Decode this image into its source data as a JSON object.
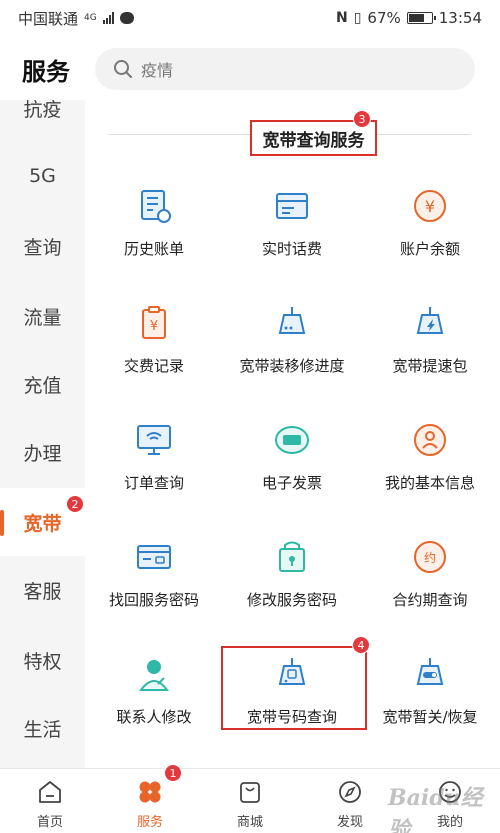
{
  "status_bar": {
    "carrier": "中国联通",
    "network": "4G",
    "battery": "67%",
    "battery_level": 0.67,
    "time": "13:54"
  },
  "header": {
    "title": "服务",
    "search_placeholder": "疫情"
  },
  "sidebar": {
    "items": [
      {
        "label": "抗疫",
        "active": false
      },
      {
        "label": "5G",
        "active": false
      },
      {
        "label": "查询",
        "active": false
      },
      {
        "label": "流量",
        "active": false
      },
      {
        "label": "充值",
        "active": false
      },
      {
        "label": "办理",
        "active": false
      },
      {
        "label": "宽带",
        "active": true
      },
      {
        "label": "客服",
        "active": false
      },
      {
        "label": "特权",
        "active": false
      },
      {
        "label": "生活",
        "active": false
      }
    ]
  },
  "section": {
    "title": "宽带查询服务"
  },
  "services": [
    {
      "label": "历史账单",
      "icon": "bill-history-icon"
    },
    {
      "label": "实时话费",
      "icon": "realtime-fee-icon"
    },
    {
      "label": "账户余额",
      "icon": "balance-yen-icon"
    },
    {
      "label": "交费记录",
      "icon": "payment-record-icon"
    },
    {
      "label": "宽带装移修进度",
      "icon": "broadband-install-icon"
    },
    {
      "label": "宽带提速包",
      "icon": "broadband-speedup-icon"
    },
    {
      "label": "订单查询",
      "icon": "order-monitor-icon"
    },
    {
      "label": "电子发票",
      "icon": "e-invoice-icon"
    },
    {
      "label": "我的基本信息",
      "icon": "user-info-icon"
    },
    {
      "label": "找回服务密码",
      "icon": "password-recover-icon"
    },
    {
      "label": "修改服务密码",
      "icon": "password-change-icon"
    },
    {
      "label": "合约期查询",
      "icon": "contract-icon"
    },
    {
      "label": "联系人修改",
      "icon": "contact-edit-icon"
    },
    {
      "label": "宽带号码查询",
      "icon": "broadband-number-icon"
    },
    {
      "label": "宽带暂关/恢复",
      "icon": "broadband-toggle-icon"
    }
  ],
  "tabbar": {
    "items": [
      {
        "label": "首页",
        "icon": "home-icon",
        "active": false
      },
      {
        "label": "服务",
        "icon": "service-clover-icon",
        "active": true
      },
      {
        "label": "商城",
        "icon": "shopping-bag-icon",
        "active": false
      },
      {
        "label": "发现",
        "icon": "compass-icon",
        "active": false
      },
      {
        "label": "我的",
        "icon": "profile-icon",
        "active": false
      }
    ]
  },
  "annotations": {
    "badge_1": "1",
    "badge_2": "2",
    "badge_3": "3",
    "badge_4": "4"
  },
  "watermark": "Baidu经验",
  "colors": {
    "accent": "#e8652a",
    "highlight_red": "#d9302a",
    "icon_blue": "#2f7fc9",
    "icon_teal": "#2eb8a6",
    "icon_orange": "#e8652a"
  }
}
